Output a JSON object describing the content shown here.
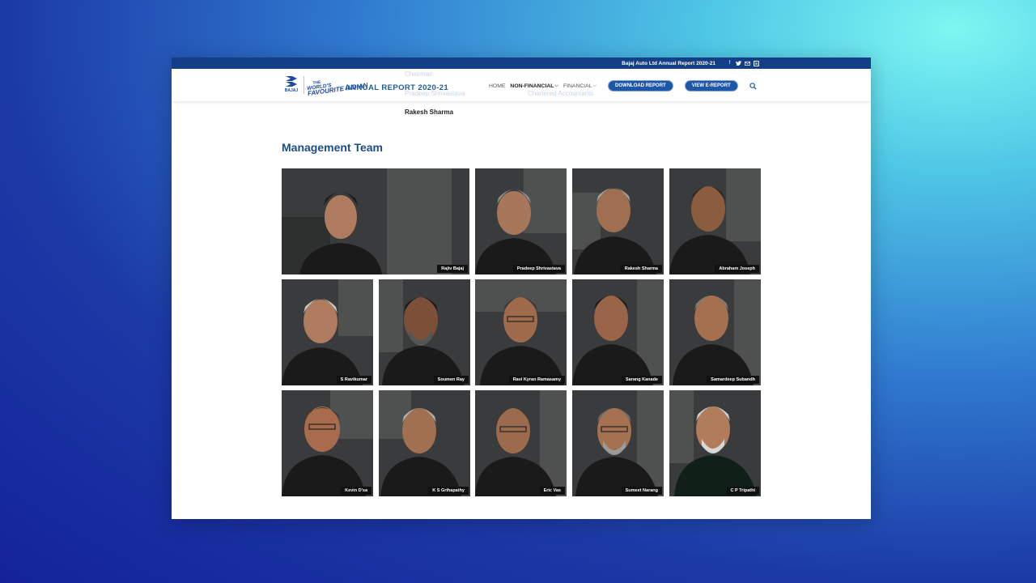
{
  "topbar": {
    "report_link": "Bajaj Auto Ltd Annual Report 2020-21",
    "social_icons": [
      "facebook-icon",
      "twitter-icon",
      "mail-icon",
      "linkedin-icon"
    ]
  },
  "header": {
    "brand": "BAJAJ",
    "tagline_1": "THE",
    "tagline_2": "WORLD'S",
    "tagline_3": "FAVOURITE INDIAN",
    "title": "ANNUAL REPORT 2020-21",
    "nav": [
      {
        "label": "HOME"
      },
      {
        "label": "NON-FINANCIAL"
      },
      {
        "label": "FINANCIAL"
      }
    ],
    "download_label": "DOWNLOAD REPORT",
    "view_label": "VIEW E-REPORT"
  },
  "faded_text": {
    "chairman": "Chairman",
    "pradeep": "Pradeep Shrivastava",
    "ghost_right": "Chartered Accountants"
  },
  "people_line": "Rakesh Sharma",
  "section_title": "Management Team",
  "team": [
    {
      "name": "Rajiv Bajaj"
    },
    {
      "name": "Pradeep Shrivastava"
    },
    {
      "name": "Rakesh Sharma"
    },
    {
      "name": "Abraham Joseph"
    },
    {
      "name": "S Ravikumar"
    },
    {
      "name": "Soumen Ray"
    },
    {
      "name": "Ravi Kyran Ramasamy"
    },
    {
      "name": "Sarang Kanade"
    },
    {
      "name": "Samardeep Subandh"
    },
    {
      "name": "Kevin D'sa"
    },
    {
      "name": "K S Grihapathy"
    },
    {
      "name": "Eric Vas"
    },
    {
      "name": "Sumeet Narang"
    },
    {
      "name": "C P Tripathi"
    }
  ],
  "colors": {
    "topbar": "#123f86",
    "accent": "#1f57a8",
    "title": "#1d4e86"
  }
}
